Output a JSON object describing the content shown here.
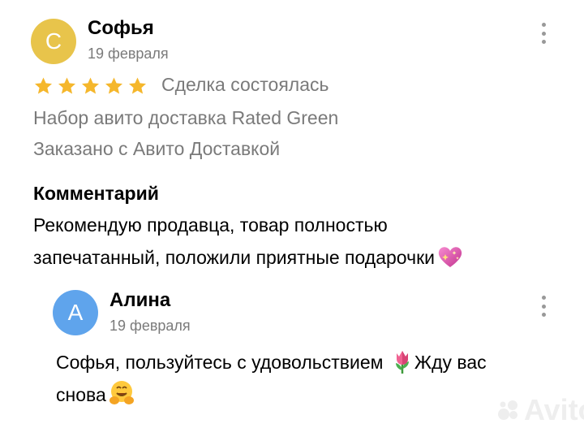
{
  "review": {
    "author": {
      "name": "Софья",
      "initial": "С",
      "avatar_color": "#E8C44B"
    },
    "date": "19 февраля",
    "rating": 5,
    "deal_status": "Сделка состоялась",
    "item": "Набор авито доставка Rated Green",
    "delivery": "Заказано с Авито Доставкой",
    "comment_heading": "Комментарий",
    "comment_line1": "Рекомендую продавца, товар полностью",
    "comment_line2": "запечатанный, положили приятные подарочки"
  },
  "reply": {
    "author": {
      "name": "Алина",
      "initial": "А",
      "avatar_color": "#5FA4EC"
    },
    "date": "19 февраля",
    "text_line1": "Софья, пользуйтесь с удовольствием",
    "text_line1_after": "Жду вас",
    "text_line2": "снова"
  },
  "colors": {
    "star": "#F5B72C",
    "secondary_text": "#7a7a7a",
    "kebab": "#999999"
  },
  "icons": [
    "more-vertical-icon",
    "star-icon",
    "sparkling-heart-emoji",
    "tulip-emoji",
    "hugging-face-emoji"
  ],
  "watermark": "Avito"
}
